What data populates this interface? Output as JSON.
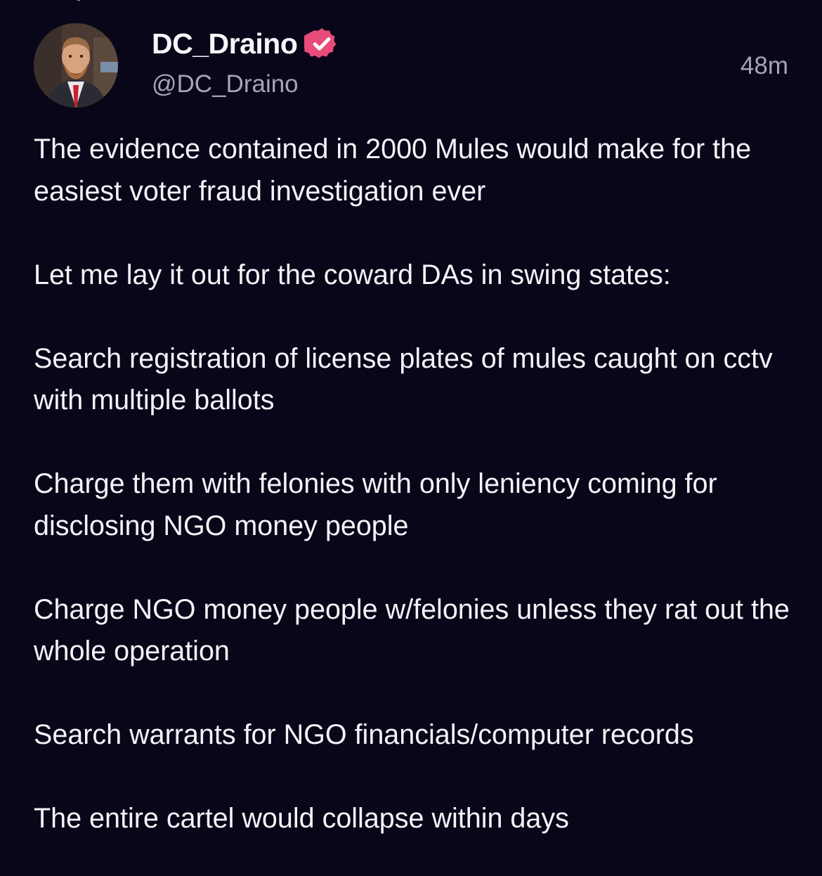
{
  "post": {
    "author": {
      "display_name": "DC_Draino",
      "handle": "@DC_Draino",
      "avatar_icon": "avatar-photo",
      "badge_icon": "verified-badge-icon",
      "badge_color": "#e74c7a"
    },
    "timestamp": "48m",
    "paragraphs": [
      "The evidence contained in 2000 Mules would make for the easiest voter fraud investigation ever",
      "Let me lay it out for the coward DAs in swing states:",
      "Search registration of license plates of mules caught on cctv with multiple ballots",
      "Charge them with felonies with only leniency coming for disclosing NGO money people",
      "Charge NGO money people w/felonies unless they rat out the whole operation",
      "Search warrants for NGO financials/computer records",
      "The entire cartel would collapse within days"
    ]
  },
  "theme": {
    "background": "#0a0619",
    "text_primary": "#f4f3f8",
    "text_secondary": "#a6a3b6",
    "accent": "#e74c7a"
  }
}
